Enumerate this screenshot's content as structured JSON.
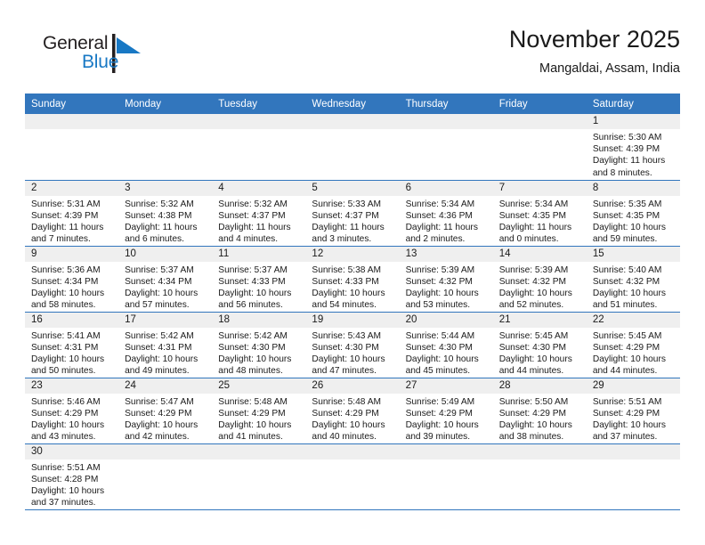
{
  "brand": {
    "name_top": "General",
    "name_bottom": "Blue",
    "flag_color": "#1878c4",
    "top_color": "#231f20"
  },
  "header": {
    "title": "November 2025",
    "subtitle": "Mangaldai, Assam, India"
  },
  "theme": {
    "header_blue": "#3276bd",
    "daynum_band": "#efefef",
    "text": "#1a1a1a"
  },
  "weekday_headers": [
    "Sunday",
    "Monday",
    "Tuesday",
    "Wednesday",
    "Thursday",
    "Friday",
    "Saturday"
  ],
  "labels": {
    "sunrise_prefix": "Sunrise:",
    "sunset_prefix": "Sunset:",
    "daylight_prefix": "Daylight:"
  },
  "weeks": [
    [
      {
        "day": "",
        "sunrise": "",
        "sunset": "",
        "daylight_1": "",
        "daylight_2": ""
      },
      {
        "day": "",
        "sunrise": "",
        "sunset": "",
        "daylight_1": "",
        "daylight_2": ""
      },
      {
        "day": "",
        "sunrise": "",
        "sunset": "",
        "daylight_1": "",
        "daylight_2": ""
      },
      {
        "day": "",
        "sunrise": "",
        "sunset": "",
        "daylight_1": "",
        "daylight_2": ""
      },
      {
        "day": "",
        "sunrise": "",
        "sunset": "",
        "daylight_1": "",
        "daylight_2": ""
      },
      {
        "day": "",
        "sunrise": "",
        "sunset": "",
        "daylight_1": "",
        "daylight_2": ""
      },
      {
        "day": "1",
        "sunrise": "Sunrise: 5:30 AM",
        "sunset": "Sunset: 4:39 PM",
        "daylight_1": "Daylight: 11 hours",
        "daylight_2": "and 8 minutes."
      }
    ],
    [
      {
        "day": "2",
        "sunrise": "Sunrise: 5:31 AM",
        "sunset": "Sunset: 4:39 PM",
        "daylight_1": "Daylight: 11 hours",
        "daylight_2": "and 7 minutes."
      },
      {
        "day": "3",
        "sunrise": "Sunrise: 5:32 AM",
        "sunset": "Sunset: 4:38 PM",
        "daylight_1": "Daylight: 11 hours",
        "daylight_2": "and 6 minutes."
      },
      {
        "day": "4",
        "sunrise": "Sunrise: 5:32 AM",
        "sunset": "Sunset: 4:37 PM",
        "daylight_1": "Daylight: 11 hours",
        "daylight_2": "and 4 minutes."
      },
      {
        "day": "5",
        "sunrise": "Sunrise: 5:33 AM",
        "sunset": "Sunset: 4:37 PM",
        "daylight_1": "Daylight: 11 hours",
        "daylight_2": "and 3 minutes."
      },
      {
        "day": "6",
        "sunrise": "Sunrise: 5:34 AM",
        "sunset": "Sunset: 4:36 PM",
        "daylight_1": "Daylight: 11 hours",
        "daylight_2": "and 2 minutes."
      },
      {
        "day": "7",
        "sunrise": "Sunrise: 5:34 AM",
        "sunset": "Sunset: 4:35 PM",
        "daylight_1": "Daylight: 11 hours",
        "daylight_2": "and 0 minutes."
      },
      {
        "day": "8",
        "sunrise": "Sunrise: 5:35 AM",
        "sunset": "Sunset: 4:35 PM",
        "daylight_1": "Daylight: 10 hours",
        "daylight_2": "and 59 minutes."
      }
    ],
    [
      {
        "day": "9",
        "sunrise": "Sunrise: 5:36 AM",
        "sunset": "Sunset: 4:34 PM",
        "daylight_1": "Daylight: 10 hours",
        "daylight_2": "and 58 minutes."
      },
      {
        "day": "10",
        "sunrise": "Sunrise: 5:37 AM",
        "sunset": "Sunset: 4:34 PM",
        "daylight_1": "Daylight: 10 hours",
        "daylight_2": "and 57 minutes."
      },
      {
        "day": "11",
        "sunrise": "Sunrise: 5:37 AM",
        "sunset": "Sunset: 4:33 PM",
        "daylight_1": "Daylight: 10 hours",
        "daylight_2": "and 56 minutes."
      },
      {
        "day": "12",
        "sunrise": "Sunrise: 5:38 AM",
        "sunset": "Sunset: 4:33 PM",
        "daylight_1": "Daylight: 10 hours",
        "daylight_2": "and 54 minutes."
      },
      {
        "day": "13",
        "sunrise": "Sunrise: 5:39 AM",
        "sunset": "Sunset: 4:32 PM",
        "daylight_1": "Daylight: 10 hours",
        "daylight_2": "and 53 minutes."
      },
      {
        "day": "14",
        "sunrise": "Sunrise: 5:39 AM",
        "sunset": "Sunset: 4:32 PM",
        "daylight_1": "Daylight: 10 hours",
        "daylight_2": "and 52 minutes."
      },
      {
        "day": "15",
        "sunrise": "Sunrise: 5:40 AM",
        "sunset": "Sunset: 4:32 PM",
        "daylight_1": "Daylight: 10 hours",
        "daylight_2": "and 51 minutes."
      }
    ],
    [
      {
        "day": "16",
        "sunrise": "Sunrise: 5:41 AM",
        "sunset": "Sunset: 4:31 PM",
        "daylight_1": "Daylight: 10 hours",
        "daylight_2": "and 50 minutes."
      },
      {
        "day": "17",
        "sunrise": "Sunrise: 5:42 AM",
        "sunset": "Sunset: 4:31 PM",
        "daylight_1": "Daylight: 10 hours",
        "daylight_2": "and 49 minutes."
      },
      {
        "day": "18",
        "sunrise": "Sunrise: 5:42 AM",
        "sunset": "Sunset: 4:30 PM",
        "daylight_1": "Daylight: 10 hours",
        "daylight_2": "and 48 minutes."
      },
      {
        "day": "19",
        "sunrise": "Sunrise: 5:43 AM",
        "sunset": "Sunset: 4:30 PM",
        "daylight_1": "Daylight: 10 hours",
        "daylight_2": "and 47 minutes."
      },
      {
        "day": "20",
        "sunrise": "Sunrise: 5:44 AM",
        "sunset": "Sunset: 4:30 PM",
        "daylight_1": "Daylight: 10 hours",
        "daylight_2": "and 45 minutes."
      },
      {
        "day": "21",
        "sunrise": "Sunrise: 5:45 AM",
        "sunset": "Sunset: 4:30 PM",
        "daylight_1": "Daylight: 10 hours",
        "daylight_2": "and 44 minutes."
      },
      {
        "day": "22",
        "sunrise": "Sunrise: 5:45 AM",
        "sunset": "Sunset: 4:29 PM",
        "daylight_1": "Daylight: 10 hours",
        "daylight_2": "and 44 minutes."
      }
    ],
    [
      {
        "day": "23",
        "sunrise": "Sunrise: 5:46 AM",
        "sunset": "Sunset: 4:29 PM",
        "daylight_1": "Daylight: 10 hours",
        "daylight_2": "and 43 minutes."
      },
      {
        "day": "24",
        "sunrise": "Sunrise: 5:47 AM",
        "sunset": "Sunset: 4:29 PM",
        "daylight_1": "Daylight: 10 hours",
        "daylight_2": "and 42 minutes."
      },
      {
        "day": "25",
        "sunrise": "Sunrise: 5:48 AM",
        "sunset": "Sunset: 4:29 PM",
        "daylight_1": "Daylight: 10 hours",
        "daylight_2": "and 41 minutes."
      },
      {
        "day": "26",
        "sunrise": "Sunrise: 5:48 AM",
        "sunset": "Sunset: 4:29 PM",
        "daylight_1": "Daylight: 10 hours",
        "daylight_2": "and 40 minutes."
      },
      {
        "day": "27",
        "sunrise": "Sunrise: 5:49 AM",
        "sunset": "Sunset: 4:29 PM",
        "daylight_1": "Daylight: 10 hours",
        "daylight_2": "and 39 minutes."
      },
      {
        "day": "28",
        "sunrise": "Sunrise: 5:50 AM",
        "sunset": "Sunset: 4:29 PM",
        "daylight_1": "Daylight: 10 hours",
        "daylight_2": "and 38 minutes."
      },
      {
        "day": "29",
        "sunrise": "Sunrise: 5:51 AM",
        "sunset": "Sunset: 4:29 PM",
        "daylight_1": "Daylight: 10 hours",
        "daylight_2": "and 37 minutes."
      }
    ],
    [
      {
        "day": "30",
        "sunrise": "Sunrise: 5:51 AM",
        "sunset": "Sunset: 4:28 PM",
        "daylight_1": "Daylight: 10 hours",
        "daylight_2": "and 37 minutes."
      },
      {
        "day": "",
        "sunrise": "",
        "sunset": "",
        "daylight_1": "",
        "daylight_2": ""
      },
      {
        "day": "",
        "sunrise": "",
        "sunset": "",
        "daylight_1": "",
        "daylight_2": ""
      },
      {
        "day": "",
        "sunrise": "",
        "sunset": "",
        "daylight_1": "",
        "daylight_2": ""
      },
      {
        "day": "",
        "sunrise": "",
        "sunset": "",
        "daylight_1": "",
        "daylight_2": ""
      },
      {
        "day": "",
        "sunrise": "",
        "sunset": "",
        "daylight_1": "",
        "daylight_2": ""
      },
      {
        "day": "",
        "sunrise": "",
        "sunset": "",
        "daylight_1": "",
        "daylight_2": ""
      }
    ]
  ]
}
